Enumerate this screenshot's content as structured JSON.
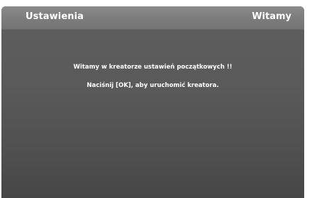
{
  "header": {
    "title": "Ustawienia",
    "page_name": "Witamy"
  },
  "body": {
    "welcome_text": "Witamy w kreatorze ustawień początkowych !!",
    "instruction_text": "Naciśnij [OK], aby uruchomić kreatora."
  },
  "colors": {
    "header_bg": "#7c7c7c",
    "body_bg": "#555555",
    "text": "#ffffff"
  }
}
